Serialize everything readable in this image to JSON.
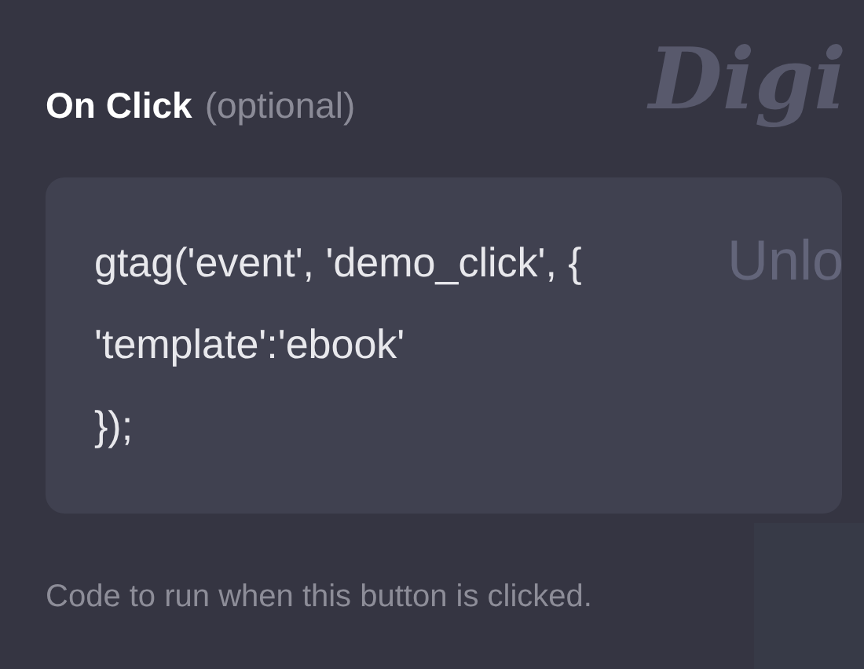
{
  "background_texts": [
    {
      "kind": "heading",
      "text": "Digi"
    },
    {
      "kind": "subheading",
      "text": "Unlo"
    }
  ],
  "field": {
    "label": "On Click",
    "hint": "(optional)",
    "code_lines": [
      "gtag('event', 'demo_click', {",
      "'template':'ebook'",
      "});"
    ],
    "help": "Code to run when this button is clicked."
  }
}
